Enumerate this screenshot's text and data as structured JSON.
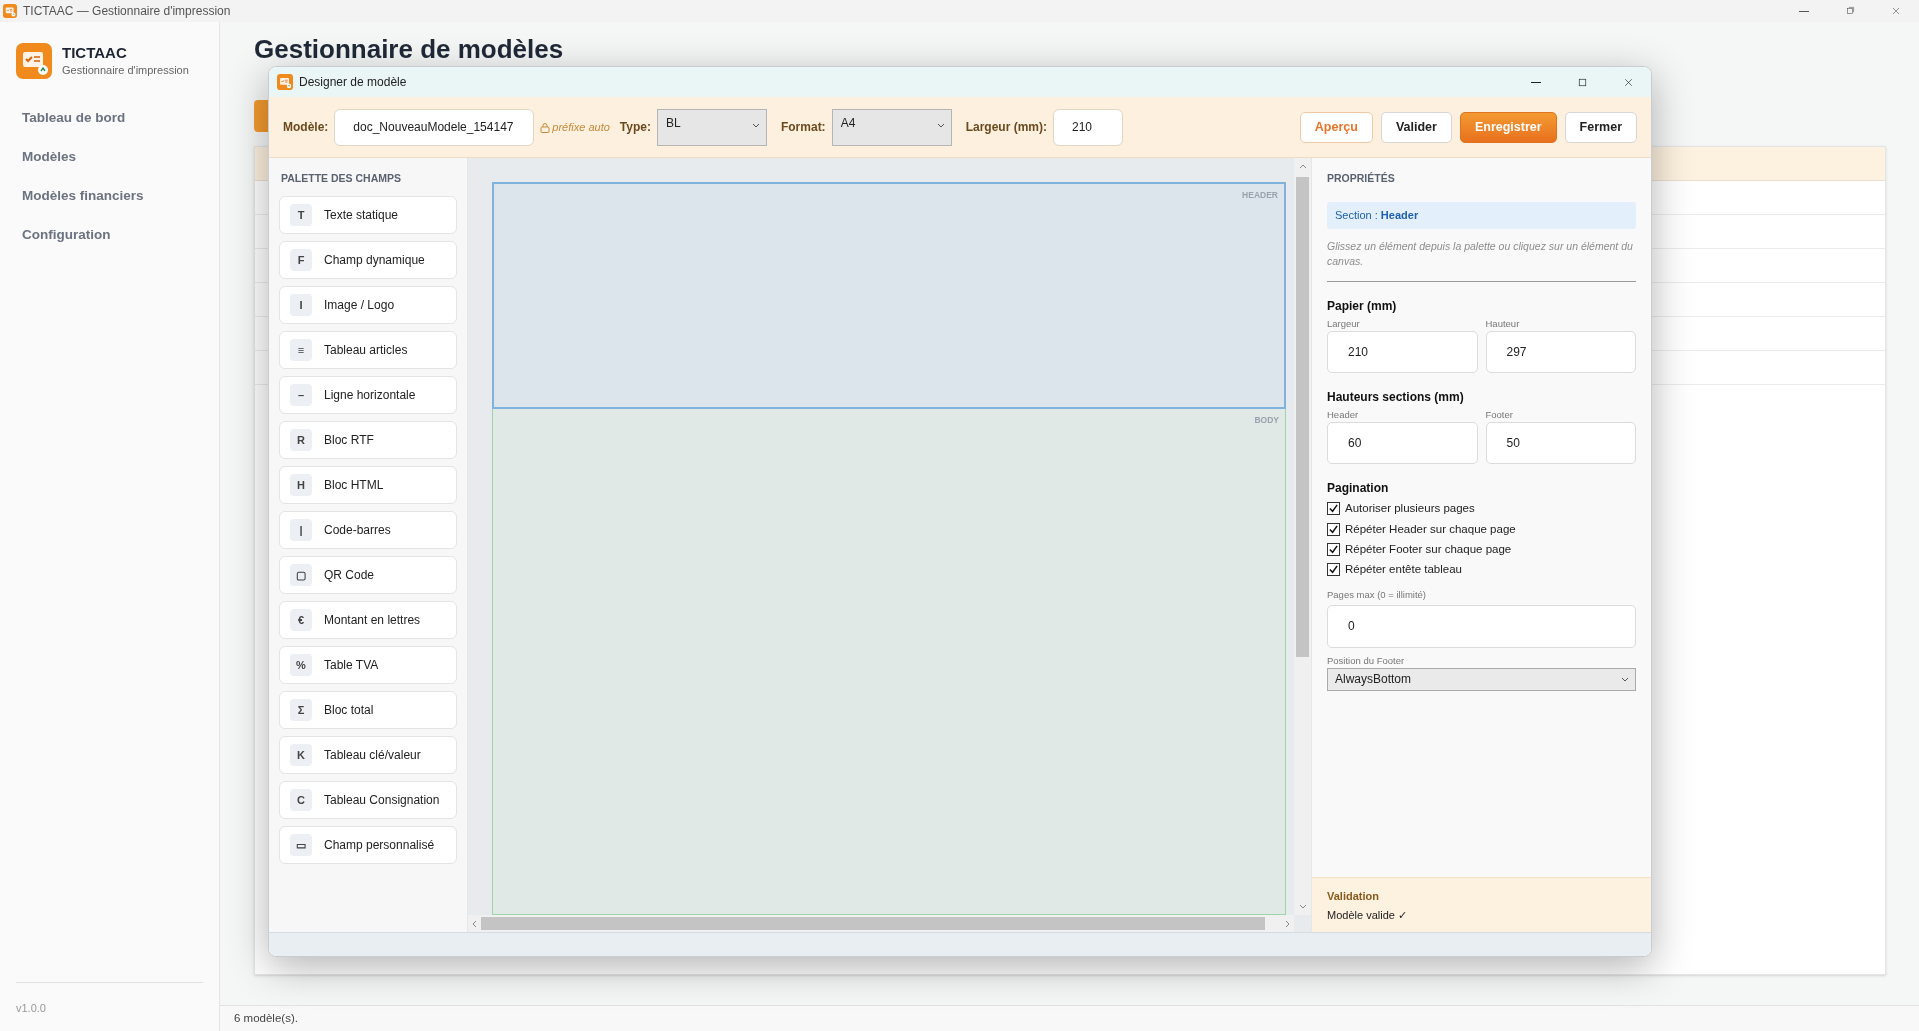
{
  "app": {
    "title": "TICTAAC — Gestionnaire d'impression",
    "brand": "TICTAAC",
    "subtitle": "Gestionnaire d'impression",
    "nav": [
      {
        "label": "Tableau de bord"
      },
      {
        "label": "Modèles"
      },
      {
        "label": "Modèles financiers"
      },
      {
        "label": "Configuration"
      }
    ],
    "version": "v1.0.0",
    "heading": "Gestionnaire de modèles",
    "status_bar": "6 modèle(s)."
  },
  "dialog": {
    "title": "Designer de modèle",
    "toolbar": {
      "model_label": "Modèle:",
      "model_value": "doc_NouveauModele_154147",
      "prefix_hint": "préfixe auto",
      "type_label": "Type:",
      "type_value": "BL",
      "format_label": "Format:",
      "format_value": "A4",
      "width_label": "Largeur (mm):",
      "width_value": "210",
      "buttons": [
        {
          "label": "Aperçu",
          "kind": "accent"
        },
        {
          "label": "Valider",
          "kind": "plain"
        },
        {
          "label": "Enregistrer",
          "kind": "primary"
        },
        {
          "label": "Fermer",
          "kind": "plain"
        }
      ]
    },
    "palette": {
      "title": "PALETTE DES CHAMPS",
      "items": [
        {
          "glyph": "T",
          "label": "Texte statique"
        },
        {
          "glyph": "F",
          "label": "Champ dynamique"
        },
        {
          "glyph": "I",
          "label": "Image / Logo"
        },
        {
          "glyph": "≡",
          "label": "Tableau articles"
        },
        {
          "glyph": "–",
          "label": "Ligne horizontale"
        },
        {
          "glyph": "R",
          "label": "Bloc RTF"
        },
        {
          "glyph": "H",
          "label": "Bloc HTML"
        },
        {
          "glyph": "|",
          "label": "Code-barres"
        },
        {
          "glyph": "▢",
          "label": "QR Code"
        },
        {
          "glyph": "€",
          "label": "Montant en lettres"
        },
        {
          "glyph": "%",
          "label": "Table TVA"
        },
        {
          "glyph": "Σ",
          "label": "Bloc total"
        },
        {
          "glyph": "K",
          "label": "Tableau clé/valeur"
        },
        {
          "glyph": "C",
          "label": "Tableau Consignation"
        },
        {
          "glyph": "▭",
          "label": "Champ personnalisé"
        }
      ]
    },
    "canvas": {
      "sections": [
        {
          "label": "HEADER",
          "color": "#7fb3de",
          "selected": true
        },
        {
          "label": "BODY",
          "color": "#9fd3a8",
          "selected": false
        }
      ]
    },
    "properties": {
      "title": "PROPRIÉTÉS",
      "section": "Section : **Header**",
      "hint": "Glissez un élément depuis la palette ou cliquez sur un élément du canvas.",
      "paper_title": "Papier (mm)",
      "paper_fields": [
        {
          "label": "Largeur",
          "value": "210"
        },
        {
          "label": "Hauteur",
          "value": "297"
        }
      ],
      "sections_title": "Hauteurs sections (mm)",
      "section_fields": [
        {
          "label": "Header",
          "value": "60"
        },
        {
          "label": "Footer",
          "value": "50"
        }
      ],
      "pagination_title": "Pagination",
      "checkboxes": [
        {
          "label": "Autoriser plusieurs pages",
          "checked": true
        },
        {
          "label": "Répéter Header sur chaque page",
          "checked": true
        },
        {
          "label": "Répéter Footer sur chaque page",
          "checked": true
        },
        {
          "label": "Répéter entête tableau",
          "checked": true
        }
      ],
      "pages_max_label": "Pages max (0 = illimité)",
      "pages_max_value": "0",
      "footer_position_label": "Position du Footer",
      "footer_position_value": "AlwaysBottom"
    },
    "validation": {
      "title": "Validation",
      "message": "Modèle valide ✓"
    }
  }
}
